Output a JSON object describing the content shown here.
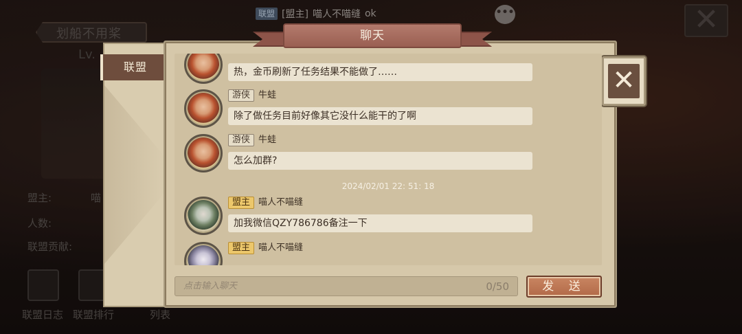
{
  "background": {
    "guild_title": "划船不用桨",
    "level": "Lv.",
    "stats": [
      {
        "label": "盟主:",
        "value": "喵"
      },
      {
        "label": "人数:",
        "value": ""
      },
      {
        "label": "联盟贡献:",
        "value": ""
      }
    ],
    "bottom_buttons": [
      "联盟日志",
      "联盟排行",
      "列表"
    ]
  },
  "notification": {
    "tags": [
      "联盟",
      "[盟主]"
    ],
    "sender": "喵人不喵缝",
    "text": "ok"
  },
  "dialog": {
    "title": "聊天",
    "close_icon": "close-x-icon",
    "tabs": [
      {
        "label": "联盟",
        "active": true
      }
    ],
    "messages": [
      {
        "role": "",
        "sender": "",
        "text": "热，金币刷新了任务结果不能做了……",
        "avatar": "red-hair-avatar"
      },
      {
        "role": "游侠",
        "sender": "牛蛙",
        "text": "除了做任务目前好像其它没什么能干的了啊",
        "avatar": "red-hair-avatar"
      },
      {
        "role": "游侠",
        "sender": "牛蛙",
        "text": "怎么加群?",
        "avatar": "red-hair-avatar"
      },
      {
        "role": "盟主",
        "sender": "喵人不喵缝",
        "text": "加我微信QZY786786备注一下",
        "avatar": "elf-avatar"
      },
      {
        "role": "盟主",
        "sender": "喵人不喵缝",
        "text": "",
        "avatar": "elf-avatar"
      }
    ],
    "timestamp": "2024/02/01 22: 51: 18",
    "input": {
      "placeholder": "点击输入聊天",
      "value": "",
      "char_count": "0/50"
    },
    "send_label": "发 送"
  },
  "colors": {
    "panel": "#d6c8aa",
    "ribbon": "#9a5f52",
    "tab_active": "#6e4d3d",
    "leader_tag": "#ecc76b",
    "send_button": "#b26a48"
  }
}
